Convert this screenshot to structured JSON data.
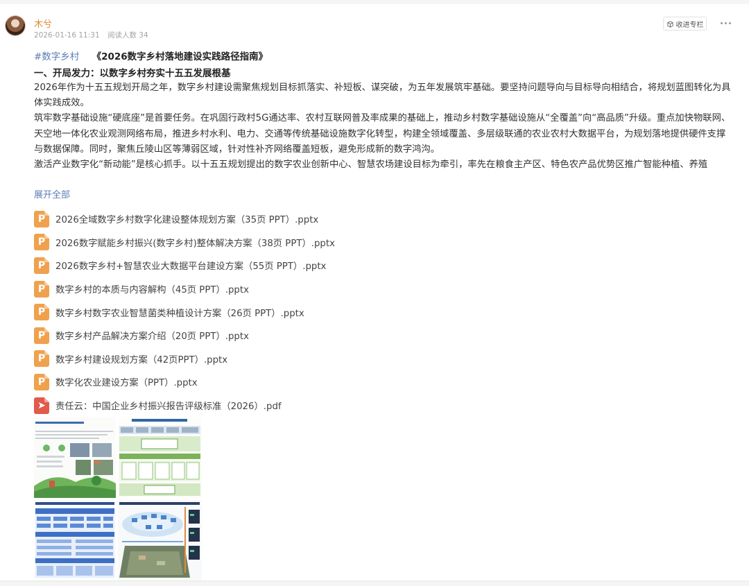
{
  "post": {
    "author": "木兮",
    "date": "2026-01-16 11:31",
    "views_label": "阅读人数 34",
    "collect_label": "收进专栏"
  },
  "content": {
    "hashtag": "#数字乡村",
    "title": "《2026数字乡村落地建设实践路径指南》",
    "section_head": "一、开局发力：以数字乡村夯实十五五发展根基",
    "paragraphs": [
      "2026年作为十五五规划开局之年，数字乡村建设需聚焦规划目标抓落实、补短板、谋突破，为五年发展筑牢基础。要坚持问题导向与目标导向相结合，将规划蓝图转化为具体实践成效。",
      "筑牢数字基础设施“硬底座”是首要任务。在巩固行政村5G通达率、农村互联网普及率成果的基础上，推动乡村数字基础设施从“全覆盖”向“高品质”升级。重点加快物联网、天空地一体化农业观测网络布局，推进乡村水利、电力、交通等传统基础设施数字化转型，构建全领域覆盖、多层级联通的农业农村大数据平台，为规划落地提供硬件支撑与数据保障。同时，聚焦丘陵山区等薄弱区域，针对性补齐网络覆盖短板，避免形成新的数字鸿沟。",
      "激活产业数字化“新动能”是核心抓手。以十五五规划提出的数字农业创新中心、智慧农场建设目标为牵引，率先在粮食主产区、特色农产品优势区推广智能种植、养殖"
    ],
    "expand_label": "展开全部"
  },
  "attachments": [
    {
      "type": "ppt",
      "name": "2026全域数字乡村数字化建设整体规划方案（35页 PPT）.pptx"
    },
    {
      "type": "ppt",
      "name": "2026数字赋能乡村振兴(数字乡村)整体解决方案（38页 PPT）.pptx"
    },
    {
      "type": "ppt",
      "name": "2026数字乡村+智慧农业大数据平台建设方案（55页 PPT）.pptx"
    },
    {
      "type": "ppt",
      "name": "数字乡村的本质与内容解构（45页 PPT）.pptx"
    },
    {
      "type": "ppt",
      "name": "数字乡村数字农业智慧菌类种植设计方案（26页 PPT）.pptx"
    },
    {
      "type": "ppt",
      "name": "数字乡村产品解决方案介绍（20页 PPT）.pptx"
    },
    {
      "type": "ppt",
      "name": "数字乡村建设规划方案（42页PPT）.pptx"
    },
    {
      "type": "ppt",
      "name": "数字化农业建设方案（PPT）.pptx"
    },
    {
      "type": "pdf",
      "name": "责任云：中国企业乡村振兴报告评级标准（2026）.pdf"
    }
  ],
  "icons": {
    "ppt_glyph": "P",
    "pdf_glyph": "➤"
  },
  "colors": {
    "author": "#e0893b",
    "link": "#5b7db8",
    "ppt": "#f0a14e",
    "pdf": "#e15b4b"
  }
}
